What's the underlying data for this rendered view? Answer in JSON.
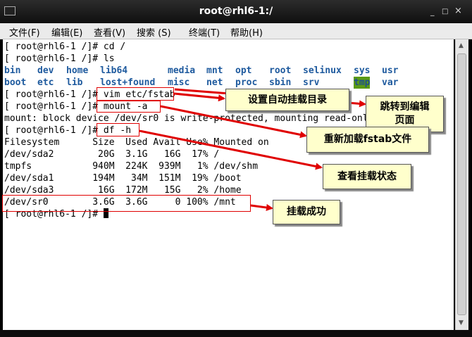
{
  "window": {
    "title": "root@rhl6-1:/",
    "minimize": "_",
    "maximize": "□",
    "close": "×"
  },
  "menu": [
    "文件(F)",
    "编辑(E)",
    "查看(V)",
    "搜索 (S)",
    "终端(T)",
    "帮助(H)"
  ],
  "terminal": {
    "prompt": "[ root@rhl6-1 /]# ",
    "cmd_cd": "cd /",
    "cmd_ls": "ls",
    "ls_row1": [
      "bin",
      "dev",
      "home",
      "lib64",
      "media",
      "mnt",
      "opt",
      "root",
      "selinux",
      "sys",
      "usr"
    ],
    "ls_row2": [
      "boot",
      "etc",
      "lib",
      "lost+found",
      "misc",
      "net",
      "proc",
      "sbin",
      "srv",
      "tmp",
      "var"
    ],
    "cmd_vim": "vim etc/fstab",
    "cmd_mount": "mount -a",
    "mount_msg": "mount: block device /dev/sr0 is write-protected, mounting read-only",
    "cmd_df": "df -h",
    "df_header": "Filesystem      Size  Used Avail Use% Mounted on",
    "df_rows": [
      "/dev/sda2        20G  3.1G   16G  17% /",
      "tmpfs           940M  224K  939M   1% /dev/shm",
      "/dev/sda1       194M   34M  151M  19% /boot",
      "/dev/sda3        16G  172M   15G   2% /home",
      "/dev/sr0        3.6G  3.6G     0 100% /mnt"
    ]
  },
  "annotations": {
    "set_dir": "设置自动挂载目录",
    "jump_edit": "跳转到编辑页面",
    "remount": "重新加载fstab文件",
    "view_status": "查看挂载状态",
    "success": "挂载成功"
  },
  "colors": {
    "ls_blue": "#1e5a9e",
    "tmp_highlight": "#5a9a14",
    "annotation_red": "#e00000",
    "callout_bg": "#ffffcc"
  }
}
